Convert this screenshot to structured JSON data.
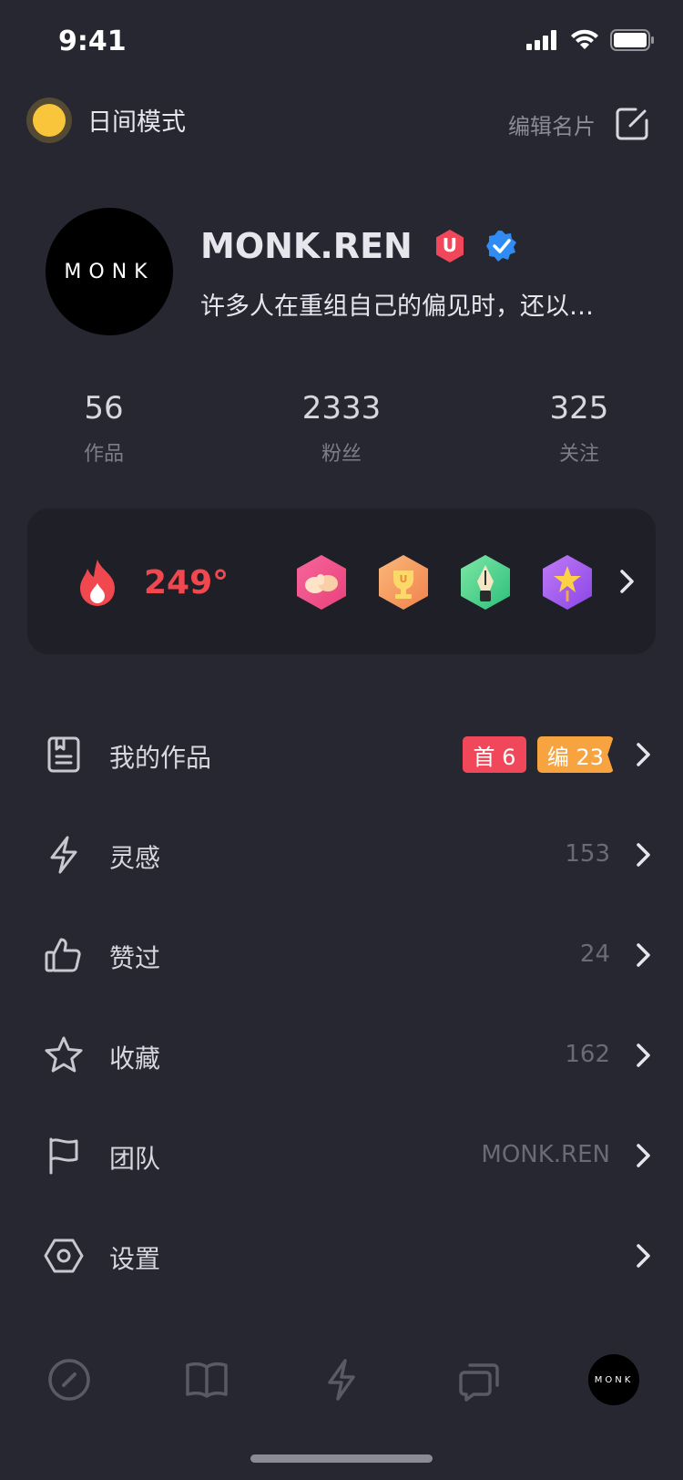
{
  "status_bar": {
    "time": "9:41"
  },
  "top": {
    "mode_label": "日间模式",
    "edit_label": "编辑名片"
  },
  "profile": {
    "avatar_text": "MONK",
    "name": "MONK.REN",
    "badge_u": "U",
    "bio": "许多人在重组自己的偏见时，还以…"
  },
  "stats": [
    {
      "value": "56",
      "label": "作品"
    },
    {
      "value": "2333",
      "label": "粉丝"
    },
    {
      "value": "325",
      "label": "关注"
    }
  ],
  "heat": {
    "value": "249°"
  },
  "menu": [
    {
      "label": "我的作品",
      "tag1": "首 6",
      "tag2": "编 23",
      "icon": "document-icon"
    },
    {
      "label": "灵感",
      "value": "153",
      "icon": "lightning-icon"
    },
    {
      "label": "赞过",
      "value": "24",
      "icon": "thumbs-up-icon"
    },
    {
      "label": "收藏",
      "value": "162",
      "icon": "star-icon"
    },
    {
      "label": "团队",
      "value": "MONK.REN",
      "icon": "flag-icon"
    },
    {
      "label": "设置",
      "value": "",
      "icon": "settings-hexagon-icon"
    }
  ],
  "tab_bar": {
    "avatar_text": "MONK"
  },
  "colors": {
    "accent_red": "#f1474f",
    "sun": "#f8c53b",
    "verified_blue": "#2f8cf5",
    "background": "#272731"
  }
}
